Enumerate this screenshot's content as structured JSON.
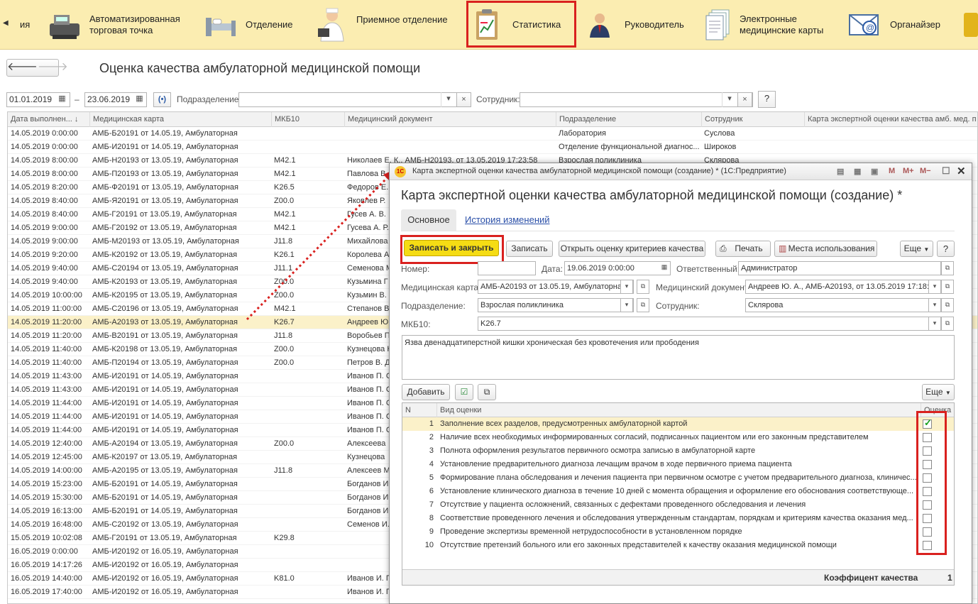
{
  "topnav": {
    "items": [
      {
        "label": "ия",
        "icon": "partial-section-icon"
      },
      {
        "label": "Автоматизированная\nторговая точка",
        "icon": "cash-register-icon"
      },
      {
        "label": "Отделение",
        "icon": "hospital-bed-icon"
      },
      {
        "label": "Приемное отделение",
        "icon": "doctor-icon"
      },
      {
        "label": "Статистика",
        "icon": "clipboard-chart-icon"
      },
      {
        "label": "Руководитель",
        "icon": "manager-icon"
      },
      {
        "label": "Электронные\nмедицинские карты",
        "icon": "documents-icon"
      },
      {
        "label": "Органайзер",
        "icon": "email-icon"
      }
    ],
    "highlight_color": "#d9211f"
  },
  "page": {
    "title": "Оценка качества амбулаторной медицинской помощи"
  },
  "filters": {
    "date_from": "01.01.2019",
    "dash": "–",
    "date_to": "23.06.2019",
    "division_label": "Подразделение:",
    "division_value": "",
    "employee_label": "Сотрудник:",
    "employee_value": "",
    "help": "?"
  },
  "list": {
    "columns": [
      "Дата выполнен... ↓",
      "Медицинская карта",
      "МКБ10",
      "Медицинский документ",
      "Подразделение",
      "Сотрудник",
      "Карта экспертной оценки качества амб. мед. п"
    ],
    "rows": [
      [
        "14.05.2019 0:00:00",
        "АМБ-Б20191 от 14.05.19, Амбулаторная",
        "",
        "",
        "Лаборатория",
        "Суслова"
      ],
      [
        "14.05.2019 0:00:00",
        "АМБ-И20191 от 14.05.19, Амбулаторная",
        "",
        "",
        "Отделение функциональной диагнос...",
        "Широков"
      ],
      [
        "14.05.2019 8:00:00",
        "АМБ-Н20193 от 13.05.19, Амбулаторная",
        "M42.1",
        "Николаев Е. К., АМБ-Н20193, от 13.05.2019 17:23:58",
        "Взрослая поликлиника",
        "Склярова"
      ],
      [
        "14.05.2019 8:00:00",
        "АМБ-П20193 от 13.05.19, Амбулаторная",
        "M42.1",
        "Павлова В.",
        "",
        ""
      ],
      [
        "14.05.2019 8:20:00",
        "АМБ-Ф20191 от 13.05.19, Амбулаторная",
        "K26.5",
        "Федоров Е.",
        "",
        ""
      ],
      [
        "14.05.2019 8:40:00",
        "АМБ-Я20191 от 13.05.19, Амбулаторная",
        "Z00.0",
        "Яковлев Р.",
        "",
        ""
      ],
      [
        "14.05.2019 8:40:00",
        "АМБ-Г20191 от 13.05.19, Амбулаторная",
        "M42.1",
        "Гусев А. В.",
        "",
        ""
      ],
      [
        "14.05.2019 9:00:00",
        "АМБ-Г20192 от 13.05.19, Амбулаторная",
        "M42.1",
        "Гусева А. Р.",
        "",
        ""
      ],
      [
        "14.05.2019 9:00:00",
        "АМБ-М20193 от 13.05.19, Амбулаторная",
        "J11.8",
        "Михайлова",
        "",
        ""
      ],
      [
        "14.05.2019 9:20:00",
        "АМБ-К20192 от 13.05.19, Амбулаторная",
        "K26.1",
        "Королева А.",
        "",
        ""
      ],
      [
        "14.05.2019 9:40:00",
        "АМБ-С20194 от 13.05.19, Амбулаторная",
        "J11.1",
        "Семенова М",
        "",
        ""
      ],
      [
        "14.05.2019 9:40:00",
        "АМБ-К20193 от 13.05.19, Амбулаторная",
        "Z00.0",
        "Кузьмина Г",
        "",
        ""
      ],
      [
        "14.05.2019 10:00:00",
        "АМБ-К20195 от 13.05.19, Амбулаторная",
        "Z00.0",
        "Кузьмин В.",
        "",
        ""
      ],
      [
        "14.05.2019 11:00:00",
        "АМБ-С20196 от 13.05.19, Амбулаторная",
        "M42.1",
        "Степанов В",
        "",
        ""
      ],
      [
        "14.05.2019 11:20:00",
        "АМБ-А20193 от 13.05.19, Амбулаторная",
        "K26.7",
        "Андреев Ю.",
        "",
        ""
      ],
      [
        "14.05.2019 11:20:00",
        "АМБ-В20191 от 13.05.19, Амбулаторная",
        "J11.8",
        "Воробьев П",
        "",
        ""
      ],
      [
        "14.05.2019 11:40:00",
        "АМБ-К20198 от 13.05.19, Амбулаторная",
        "Z00.0",
        "Кузнецова Н",
        "",
        ""
      ],
      [
        "14.05.2019 11:40:00",
        "АМБ-П20194 от 13.05.19, Амбулаторная",
        "Z00.0",
        "Петров В. Д",
        "",
        ""
      ],
      [
        "14.05.2019 11:43:00",
        "АМБ-И20191 от 14.05.19, Амбулаторная",
        "",
        "Иванов П. С",
        "",
        ""
      ],
      [
        "14.05.2019 11:43:00",
        "АМБ-И20191 от 14.05.19, Амбулаторная",
        "",
        "Иванов П. С",
        "",
        ""
      ],
      [
        "14.05.2019 11:44:00",
        "АМБ-И20191 от 14.05.19, Амбулаторная",
        "",
        "Иванов П. С",
        "",
        ""
      ],
      [
        "14.05.2019 11:44:00",
        "АМБ-И20191 от 14.05.19, Амбулаторная",
        "",
        "Иванов П. С",
        "",
        ""
      ],
      [
        "14.05.2019 11:44:00",
        "АМБ-И20191 от 14.05.19, Амбулаторная",
        "",
        "Иванов П. С",
        "",
        ""
      ],
      [
        "14.05.2019 12:40:00",
        "АМБ-А20194 от 13.05.19, Амбулаторная",
        "Z00.0",
        "Алексеева",
        "",
        ""
      ],
      [
        "14.05.2019 12:45:00",
        "АМБ-К20197 от 13.05.19, Амбулаторная",
        "",
        "Кузнецова",
        "",
        ""
      ],
      [
        "14.05.2019 14:00:00",
        "АМБ-А20195 от 13.05.19, Амбулаторная",
        "J11.8",
        "Алексеев М",
        "",
        ""
      ],
      [
        "14.05.2019 15:23:00",
        "АМБ-Б20191 от 14.05.19, Амбулаторная",
        "",
        "Богданов И",
        "",
        ""
      ],
      [
        "14.05.2019 15:30:00",
        "АМБ-Б20191 от 14.05.19, Амбулаторная",
        "",
        "Богданов И",
        "",
        ""
      ],
      [
        "14.05.2019 16:13:00",
        "АМБ-Б20191 от 14.05.19, Амбулаторная",
        "",
        "Богданов И",
        "",
        ""
      ],
      [
        "14.05.2019 16:48:00",
        "АМБ-С20192 от 13.05.19, Амбулаторная",
        "",
        "Семенов И.",
        "",
        ""
      ],
      [
        "15.05.2019 10:02:08",
        "АМБ-Г20191 от 13.05.19, Амбулаторная",
        "K29.8",
        "",
        "",
        ""
      ],
      [
        "16.05.2019 0:00:00",
        "АМБ-И20192 от 16.05.19, Амбулаторная",
        "",
        "",
        "",
        ""
      ],
      [
        "16.05.2019 14:17:26",
        "АМБ-И20192 от 16.05.19, Амбулаторная",
        "",
        "",
        "",
        ""
      ],
      [
        "16.05.2019 14:40:00",
        "АМБ-И20192 от 16.05.19, Амбулаторная",
        "K81.0",
        "Иванов И. П",
        "",
        ""
      ],
      [
        "16.05.2019 17:40:00",
        "АМБ-И20192 от 16.05.19, Амбулаторная",
        "",
        "Иванов И. П",
        "",
        ""
      ]
    ],
    "selected_row": 14
  },
  "dialog": {
    "window_title": "Карта экспертной оценки качества амбулаторной медицинской помощи (создание) * (1С:Предприятие)",
    "logo": "1С",
    "header": "Карта экспертной оценки качества амбулаторной медицинской помощи (создание) *",
    "tabs": [
      "Основное",
      "История изменений"
    ],
    "toolbar": {
      "save_close": "Записать и закрыть",
      "save": "Записать",
      "open_eval": "Открыть оценку критериев качества",
      "print": "Печать",
      "usage": "Места использования",
      "more": "Еще",
      "help": "?"
    },
    "form": {
      "number_label": "Номер:",
      "number_value": "",
      "date_label": "Дата:",
      "date_value": "19.06.2019  0:00:00",
      "resp_label": "Ответственный:",
      "resp_value": "Администратор",
      "card_label": "Медицинская карта:",
      "card_value": "АМБ-А20193 от 13.05.19, Амбулаторна",
      "doc_label": "Медицинский документ:",
      "doc_value": "Андреев Ю. А., АМБ-А20193, от 13.05.2019 17:18:",
      "div_label": "Подразделение:",
      "div_value": "Взрослая поликлиника",
      "emp_label": "Сотрудник:",
      "emp_value": "Склярова",
      "mkb_label": "МКБ10:",
      "mkb_value": "K26.7",
      "diagnosis": "Язва двенадцатиперстной кишки хроническая без кровотечения или прободения"
    },
    "table": {
      "add": "Добавить",
      "more": "Еще",
      "col_n": "N",
      "col_kind": "Вид оценки",
      "col_score": "Оценка",
      "rows": [
        {
          "n": "1",
          "text": "Заполнение всех разделов, предусмотренных амбулаторной картой",
          "checked": true
        },
        {
          "n": "2",
          "text": "Наличие всех необходимых информированных согласий, подписанных пациентом или его законным представителем",
          "checked": false
        },
        {
          "n": "3",
          "text": "Полнота оформления результатов первичного осмотра записью в амбулаторной карте",
          "checked": false
        },
        {
          "n": "4",
          "text": "Установление предварительного диагноза лечащим врачом в ходе первичного приема пациента",
          "checked": false
        },
        {
          "n": "5",
          "text": "Формирование плана обследования и лечения пациента при первичном осмотре с учетом предварительного диагноза, клиничес...",
          "checked": false
        },
        {
          "n": "6",
          "text": "Установление клинического диагноза в течение 10 дней с момента обращения и оформление его обоснования соответствующе...",
          "checked": false
        },
        {
          "n": "7",
          "text": "Отсутствие у пациента осложнений, связанных с дефектами проведенного обследования и лечения",
          "checked": false
        },
        {
          "n": "8",
          "text": "Соответствие проведенного лечения и обследования утвержденным стандартам, порядкам и критериям качества оказания мед...",
          "checked": false
        },
        {
          "n": "9",
          "text": "Проведение экспертизы временной нетрудоспособности в установленном порядке",
          "checked": false
        },
        {
          "n": "10",
          "text": "Отсутствие претензий больного или его законных представителей к качеству оказания медицинской помощи",
          "checked": false
        }
      ],
      "footer_label": "Коэффицент качества",
      "footer_value": "1"
    }
  }
}
